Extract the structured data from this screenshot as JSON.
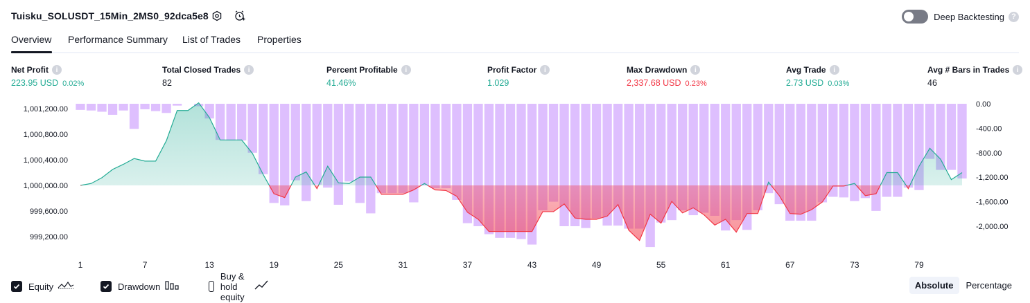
{
  "header": {
    "title": "Tuisku_SOLUSDT_15Min_2MS0_92dca5e8",
    "deep_backtesting_label": "Deep Backtesting",
    "deep_backtesting_enabled": false
  },
  "tabs": [
    {
      "label": "Overview",
      "active": true
    },
    {
      "label": "Performance Summary",
      "active": false
    },
    {
      "label": "List of Trades",
      "active": false
    },
    {
      "label": "Properties",
      "active": false
    }
  ],
  "metrics": [
    {
      "label": "Net Profit",
      "value": "223.95 USD",
      "sub": "0.02%",
      "color": "#22ab94"
    },
    {
      "label": "Total Closed Trades",
      "value": "82",
      "sub": "",
      "color": "#131722"
    },
    {
      "label": "Percent Profitable",
      "value": "41.46%",
      "sub": "",
      "color": "#22ab94"
    },
    {
      "label": "Profit Factor",
      "value": "1.029",
      "sub": "",
      "color": "#22ab94"
    },
    {
      "label": "Max Drawdown",
      "value": "2,337.68 USD",
      "sub": "0.23%",
      "color": "#f23645"
    },
    {
      "label": "Avg Trade",
      "value": "2.73 USD",
      "sub": "0.03%",
      "color": "#22ab94"
    },
    {
      "label": "Avg # Bars in Trades",
      "value": "46",
      "sub": "",
      "color": "#131722"
    }
  ],
  "chart_data": {
    "type": "area",
    "baseline": 1000000,
    "x_ticks": [
      "1",
      "7",
      "13",
      "19",
      "25",
      "31",
      "37",
      "43",
      "49",
      "55",
      "61",
      "67",
      "73",
      "79"
    ],
    "y_left_ticks": [
      "1,001,200.00",
      "1,000,800.00",
      "1,000,400.00",
      "1,000,000.00",
      "999,600.00",
      "999,200.00"
    ],
    "y_left_range": [
      999100,
      1001300
    ],
    "y_right_ticks": [
      "0.00",
      "-400.00",
      "-800.00",
      "-1,200.00",
      "-1,600.00",
      "-2,000.00"
    ],
    "y_right_range": [
      -2400,
      0
    ],
    "equity": [
      1000000,
      1000030,
      1000120,
      1000250,
      1000330,
      1000420,
      1000380,
      1000380,
      1000700,
      1001170,
      1001170,
      1001290,
      1001060,
      1000710,
      1000710,
      1000710,
      1000500,
      1000170,
      999870,
      999810,
      1000130,
      1000210,
      999950,
      1000300,
      1000040,
      1000030,
      1000130,
      1000130,
      999860,
      999860,
      999860,
      999930,
      1000030,
      999930,
      999920,
      999830,
      999580,
      999470,
      999280,
      999280,
      999280,
      999280,
      999280,
      999590,
      999590,
      999710,
      999490,
      999470,
      999470,
      999520,
      999700,
      999300,
      999140,
      999550,
      999410,
      999750,
      999570,
      999650,
      999540,
      999380,
      999470,
      999270,
      999560,
      999560,
      1000050,
      999840,
      999560,
      999550,
      999620,
      999740,
      999990,
      999990,
      1000030,
      999840,
      999870,
      1000200,
      1000200,
      999950,
      1000300,
      1000580,
      1000410,
      1000090,
      1000200
    ],
    "drawdown": [
      -100,
      -110,
      -130,
      -180,
      -110,
      -410,
      -90,
      -120,
      -150,
      -30,
      0,
      -40,
      -240,
      -590,
      -600,
      -600,
      -800,
      -1150,
      -1620,
      -1660,
      -1250,
      -1590,
      -1320,
      -1370,
      -1650,
      -1270,
      -1620,
      -1790,
      -1460,
      -1460,
      -1460,
      -1610,
      -1330,
      -1380,
      -1380,
      -1570,
      -1950,
      -2000,
      -2130,
      -2190,
      -2190,
      -2210,
      -2300,
      -1740,
      -1600,
      -2000,
      -2000,
      -2030,
      -1870,
      -1990,
      -1990,
      -2040,
      -2040,
      -2340,
      -1940,
      -1900,
      -1740,
      -1820,
      -1780,
      -1830,
      -2070,
      -1900,
      -2060,
      -1740,
      -1460,
      -1640,
      -1910,
      -1910,
      -1910,
      -1610,
      -1520,
      -1530,
      -1590,
      -1540,
      -1750,
      -1520,
      -1520,
      -1370,
      -1410,
      -900,
      -1080,
      -1080,
      -1220
    ]
  },
  "legend": [
    {
      "label": "Equity",
      "checked": true,
      "icon": "equity-wave-icon"
    },
    {
      "label": "Drawdown",
      "checked": true,
      "icon": "drawdown-bars-icon"
    },
    {
      "label": "Buy & hold equity",
      "checked": false,
      "icon": "buy-hold-line-icon"
    }
  ],
  "scale_toggle": [
    {
      "label": "Absolute",
      "active": true
    },
    {
      "label": "Percentage",
      "active": false
    }
  ]
}
